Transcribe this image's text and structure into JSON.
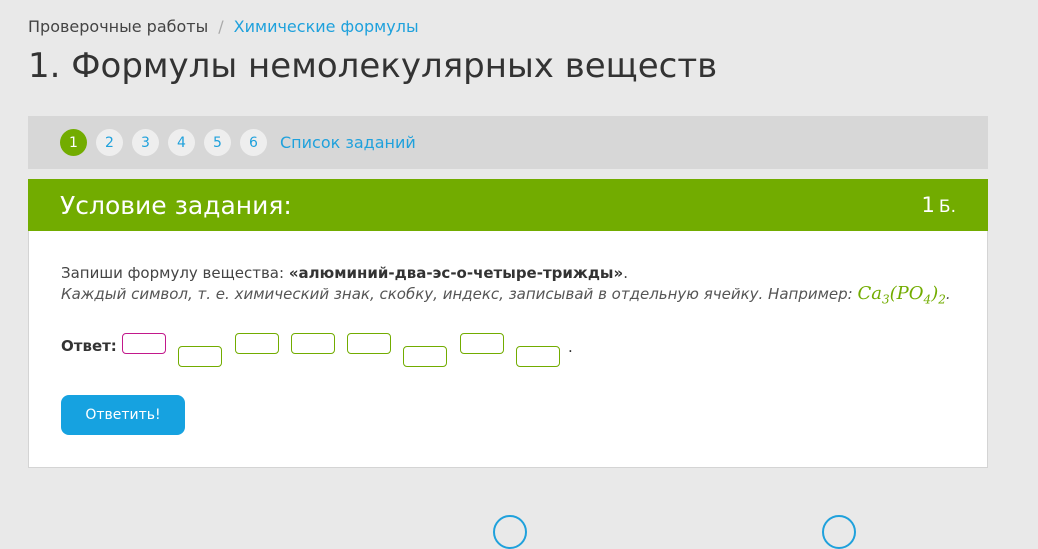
{
  "breadcrumb": {
    "parent": "Проверочные работы",
    "separator": "/",
    "current": "Химические формулы"
  },
  "page_title": "1. Формулы немолекулярных веществ",
  "tasks_nav": {
    "numbers": [
      "1",
      "2",
      "3",
      "4",
      "5",
      "6"
    ],
    "active": "1",
    "list_link": "Список заданий"
  },
  "task": {
    "header_title": "Условие задания:",
    "points_value": "1",
    "points_unit": "Б.",
    "instruction_prefix": "Запиши формулу вещества: ",
    "substance_name": "«алюминий-два-эс-о-четыре-трижды»",
    "instruction_suffix": ".",
    "hint": "Каждый символ, т. е. химический знак, скобку, индекс, записывай в отдельную ячейку. Например: ",
    "example_formula": {
      "ca": "Ca",
      "sub1": "3",
      "open": "(",
      "po": "PO",
      "sub2": "4",
      "close": ")",
      "sub3": "2"
    },
    "example_end": ".",
    "answer_label": "Ответ:",
    "answer_end": ".",
    "answer_cells": [
      "",
      "",
      "",
      "",
      "",
      "",
      "",
      ""
    ],
    "submit_label": "Ответить!"
  }
}
